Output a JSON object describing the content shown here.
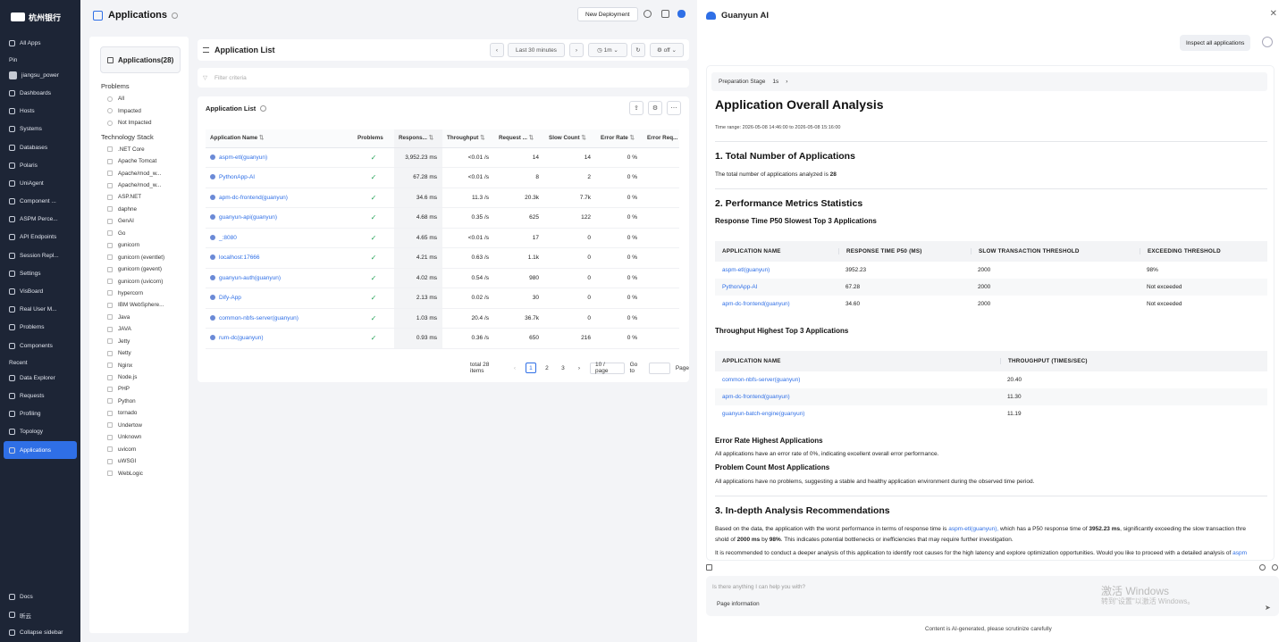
{
  "brand": {
    "logo_text": "杭州银行"
  },
  "sidebar": {
    "all_apps": "All Apps",
    "pin_label": "Pin",
    "pinned": [
      "jiangsu_power",
      "Dashboards",
      "Hosts",
      "Systems",
      "Databases",
      "Polaris",
      "UniAgent",
      "Component ...",
      "ASPM Perce...",
      "API Endpoints",
      "Session Repl...",
      "Settings",
      "VisBoard",
      "Real User M...",
      "Problems",
      "Components"
    ],
    "recent_label": "Recent",
    "recent": [
      "Data Explorer",
      "Requests",
      "Profiling",
      "Topology",
      "Applications"
    ],
    "bottom": [
      "Docs",
      "昕云",
      "Collapse sidebar"
    ]
  },
  "header": {
    "title": "Applications",
    "new_deployment": "New Deployment"
  },
  "left_panel": {
    "apps_count": "Applications(28)",
    "problems_heading": "Problems",
    "problems": [
      "All",
      "Impacted",
      "Not Impacted"
    ],
    "tech_heading": "Technology Stack",
    "tech": [
      ".NET Core",
      "Apache Tomcat",
      "Apache/mod_w...",
      "Apache/mod_w...",
      "ASP.NET",
      "daphne",
      "GenAI",
      "Go",
      "gunicorn",
      "gunicorn (eventlet)",
      "gunicorn (gevent)",
      "gunicorn (uvicorn)",
      "hypercorn",
      "IBM WebSphere...",
      "Java",
      "JAVA",
      "Jetty",
      "Netty",
      "Nginx",
      "Node.js",
      "PHP",
      "Python",
      "tornado",
      "Undertow",
      "Unknown",
      "uvicorn",
      "uWSGI",
      "WebLogic"
    ]
  },
  "list_header": {
    "title": "Application List",
    "range": "Last 30 minutes",
    "interval": "1m",
    "refresh": "off"
  },
  "filter": {
    "placeholder": "Filter criteria"
  },
  "table": {
    "title": "Application List",
    "columns": [
      "Application Name",
      "Problems",
      "Respons...",
      "Throughput",
      "Request ...",
      "Slow Count",
      "Error Rate",
      "Error Req..."
    ],
    "rows": [
      {
        "name": "aspm-etl(guanyun)",
        "resp": "3,952.23 ms",
        "thr": "<0.01 /s",
        "req": "14",
        "slow": "14",
        "err": "0 %"
      },
      {
        "name": "PythonApp-AI",
        "resp": "67.28 ms",
        "thr": "<0.01 /s",
        "req": "8",
        "slow": "2",
        "err": "0 %"
      },
      {
        "name": "apm-dc-frontend(guanyun)",
        "resp": "34.6 ms",
        "thr": "11.3 /s",
        "req": "20.3k",
        "slow": "7.7k",
        "err": "0 %"
      },
      {
        "name": "guanyun-api(guanyun)",
        "resp": "4.68 ms",
        "thr": "0.35 /s",
        "req": "625",
        "slow": "122",
        "err": "0 %"
      },
      {
        "name": "_:8080",
        "resp": "4.65 ms",
        "thr": "<0.01 /s",
        "req": "17",
        "slow": "0",
        "err": "0 %"
      },
      {
        "name": "localhost:17666",
        "resp": "4.21 ms",
        "thr": "0.63 /s",
        "req": "1.1k",
        "slow": "0",
        "err": "0 %"
      },
      {
        "name": "guanyun-auth(guanyun)",
        "resp": "4.02 ms",
        "thr": "0.54 /s",
        "req": "980",
        "slow": "0",
        "err": "0 %"
      },
      {
        "name": "Dify-App",
        "resp": "2.13 ms",
        "thr": "0.02 /s",
        "req": "30",
        "slow": "0",
        "err": "0 %"
      },
      {
        "name": "common-nbfs-server(guanyun)",
        "resp": "1.03 ms",
        "thr": "20.4 /s",
        "req": "36.7k",
        "slow": "0",
        "err": "0 %"
      },
      {
        "name": "rum-dc(guanyun)",
        "resp": "0.93 ms",
        "thr": "0.36 /s",
        "req": "650",
        "slow": "216",
        "err": "0 %"
      }
    ],
    "ok_glyph": "✓",
    "pager": {
      "total": "total 28 items",
      "pages": [
        "1",
        "2",
        "3"
      ],
      "size": "10 / page",
      "goto": "Go to",
      "page": "Page"
    }
  },
  "ai": {
    "title": "Guanyun AI",
    "inspect": "Inspect all applications",
    "stage": "Preparation Stage",
    "stage_time": "1s",
    "report_title": "Application Overall Analysis",
    "time_range": "Time range: 2026-05-08 14:46:00 to 2026-05-08 15:16:00",
    "s1": "1. Total Number of Applications",
    "s1_text": "The total number of applications analyzed is",
    "s1_num": "28",
    "s2": "2. Performance Metrics Statistics",
    "s2a": "Response Time P50 Slowest Top 3 Applications",
    "t1_head": [
      "APPLICATION NAME",
      "RESPONSE TIME P50 (MS)",
      "SLOW TRANSACTION THRESHOLD",
      "EXCEEDING THRESHOLD"
    ],
    "t1_rows": [
      [
        "aspm-etl(guanyun)",
        "3952.23",
        "2000",
        "98%"
      ],
      [
        "PythonApp-AI",
        "67.28",
        "2000",
        "Not exceeded"
      ],
      [
        "apm-dc-frontend(guanyun)",
        "34.60",
        "2000",
        "Not exceeded"
      ]
    ],
    "s2b": "Throughput Highest Top 3 Applications",
    "t2_head": [
      "APPLICATION NAME",
      "THROUGHPUT (TIMES/SEC)"
    ],
    "t2_rows": [
      [
        "common-nbfs-server(guanyun)",
        "20.40"
      ],
      [
        "apm-dc-frontend(guanyun)",
        "11.30"
      ],
      [
        "guanyun-batch-engine(guanyun)",
        "11.19"
      ]
    ],
    "s2c": "Error Rate Highest Applications",
    "s2c_text": "All applications have an error rate of 0%, indicating excellent overall error performance.",
    "s2d": "Problem Count Most Applications",
    "s2d_text": "All applications have no problems, suggesting a stable and healthy application environment during the observed time period.",
    "s3": "3. In-depth Analysis Recommendations",
    "s3_l1a": "Based on the data, the application with the worst performance in terms of response time is",
    "s3_l1b": "aspm-etl(guanyun),",
    "s3_l1c": "which has a P50 response time of",
    "s3_l1d": "3952.23 ms",
    "s3_l1e": ", significantly exceeding the slow transaction thre",
    "s3_l2a": "shold of",
    "s3_l2b": "2000 ms",
    "s3_l2c": "by",
    "s3_l2d": "98%",
    "s3_l2e": ". This indicates potential bottlenecks or inefficiencies that may require further investigation.",
    "s3_l3": "It is recommended to conduct a deeper analysis of this application to identify root causes for the high latency and explore optimization opportunities. Would you like to proceed with a detailed analysis of",
    "s3_l3b": "aspm",
    "chat_placeholder": "Is there anything I can help you with?",
    "page_info": "Page information",
    "watermark1": "激活 Windows",
    "watermark2": "转到\"设置\"以激活 Windows。",
    "footnote": "Content is AI-generated, please scrutinize carefully"
  }
}
